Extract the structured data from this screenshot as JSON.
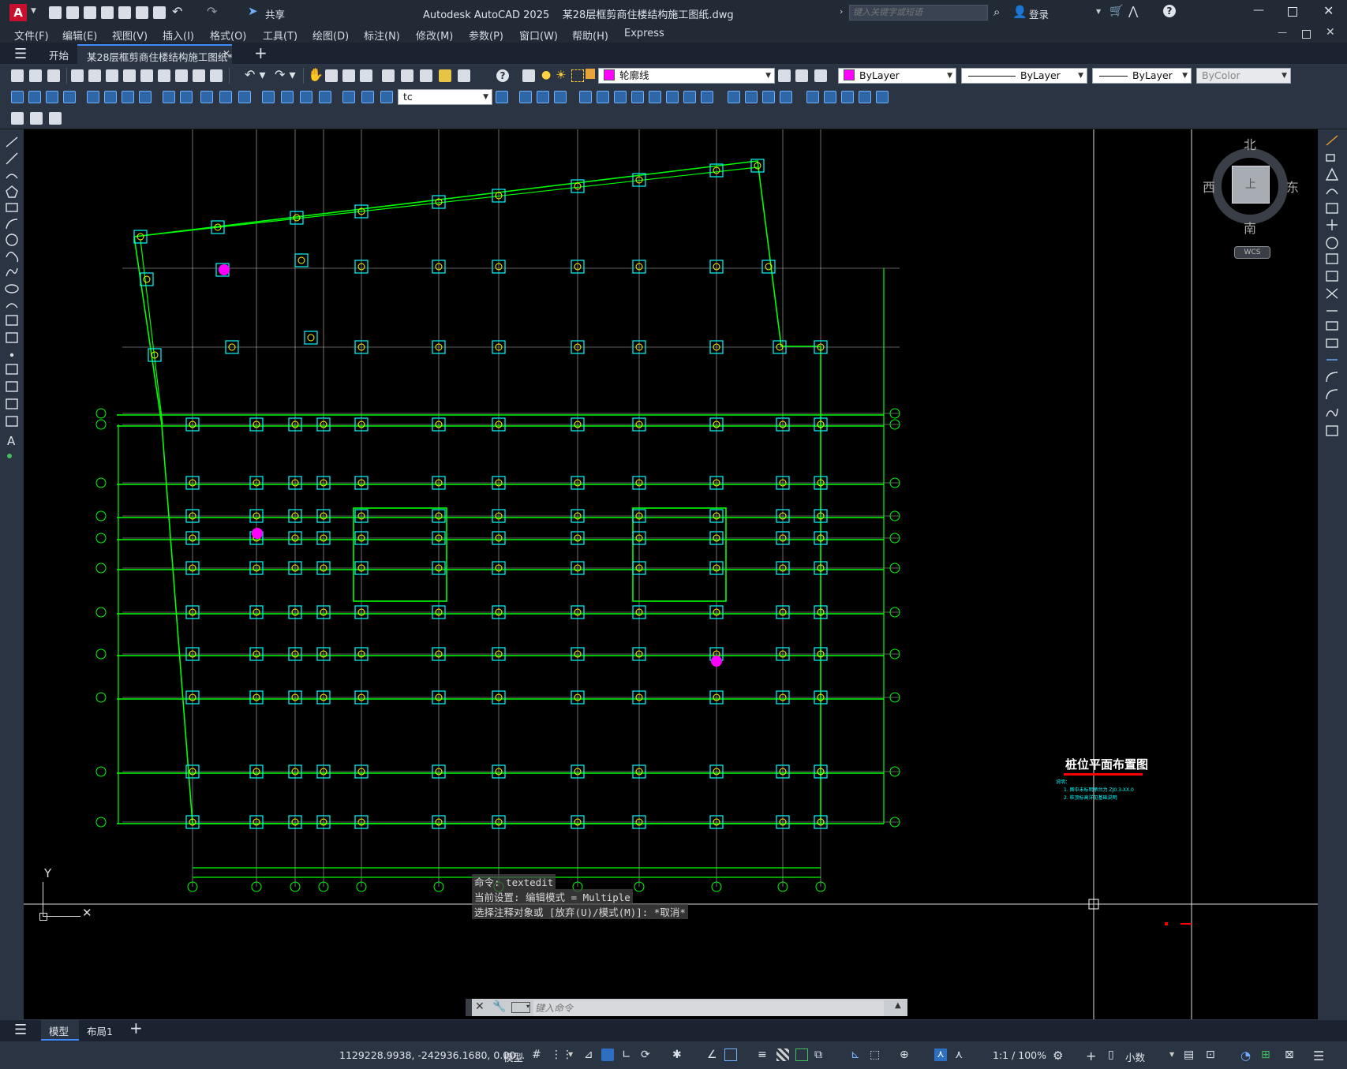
{
  "app": {
    "title": "Autodesk AutoCAD 2025",
    "document": "某28层框剪商住楼结构施工图纸.dwg",
    "share_label": "共享",
    "search_placeholder": "键入关键字或短语",
    "login_label": "登录"
  },
  "menu": [
    "文件(F)",
    "编辑(E)",
    "视图(V)",
    "插入(I)",
    "格式(O)",
    "工具(T)",
    "绘图(D)",
    "标注(N)",
    "修改(M)",
    "参数(P)",
    "窗口(W)",
    "帮助(H)",
    "Express"
  ],
  "tabs": {
    "home": "开始",
    "active": "某28层框剪商住楼结构施工图纸*"
  },
  "toolbar": {
    "layer_name": "轮廓线",
    "color": "ByLayer",
    "linetype": "ByLayer",
    "lineweight": "ByLayer",
    "plotstyle": "ByColor",
    "text_style": "tc"
  },
  "viewcube": {
    "north": "北",
    "south": "南",
    "east": "东",
    "west": "西",
    "top": "上",
    "wcs": "WCS"
  },
  "drawing": {
    "title": "桩位平面布置图",
    "note_header": "说明：",
    "notes": [
      "1. 图中未标明承台为 ZJ0.3-XX.0",
      "2. 桩顶标高详见基础说明"
    ],
    "ucs_y": "Y"
  },
  "command": {
    "history": [
      "命令:  textedit",
      "当前设置: 编辑模式 = Multiple",
      "选择注释对象或 [放弃(U)/模式(M)]: *取消*"
    ],
    "input_placeholder": "键入命令"
  },
  "layout_tabs": [
    "模型",
    "布局1"
  ],
  "status": {
    "coords": "1129228.9938, -242936.1680, 0.00...",
    "space": "模型",
    "scale": "1:1 / 100%",
    "units": "小数"
  },
  "colors": {
    "grid_line": "#bdbdbd",
    "beam": "#00ff00",
    "pile_cap": "#00ffff",
    "pile": "#ffff00",
    "highlight": "#ff00ff",
    "title_underline": "#ff0000"
  }
}
